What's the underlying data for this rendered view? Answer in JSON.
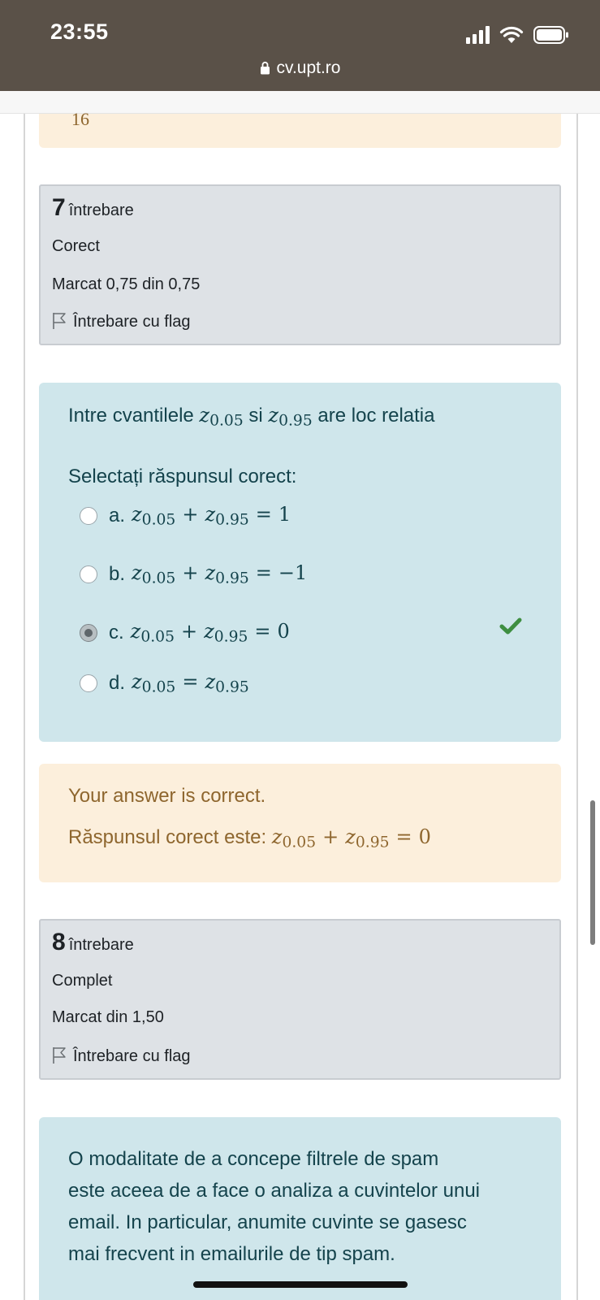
{
  "status_bar": {
    "time": "23:55",
    "url": "cv.upt.ro"
  },
  "prev_feedback_fragment": "16",
  "q7": {
    "number": "7",
    "label": "întrebare",
    "state": "Corect",
    "mark": "Marcat 0,75 din 0,75",
    "flag": "Întrebare cu flag",
    "text_prefix": "Intre cvantilele",
    "text_mid": "si",
    "text_suffix": "are loc relatia",
    "z": "z",
    "sub_a": "0.05",
    "sub_b": "0.95",
    "prompt": "Selectați răspunsul corect:",
    "options": [
      {
        "letter": "a.",
        "rhs": "1",
        "selected": false
      },
      {
        "letter": "b.",
        "rhs": "−1",
        "selected": false
      },
      {
        "letter": "c.",
        "rhs": "0",
        "selected": true
      },
      {
        "letter": "d.",
        "rhs": "",
        "selected": false
      }
    ],
    "feedback_correct": "Your answer is correct.",
    "feedback_answer": "Răspunsul corect este:",
    "answer_rhs": "0",
    "accent_correct": "#3e8e41"
  },
  "q8": {
    "number": "8",
    "label": "întrebare",
    "state": "Complet",
    "mark": "Marcat din 1,50",
    "flag": "Întrebare cu flag",
    "text_lines": [
      "O modalitate de a concepe filtrele de spam",
      "este aceea de a face o analiza a cuvintelor unui",
      "email. In particular, anumite cuvinte se gasesc",
      "mai frecvent in emailurile de tip spam."
    ]
  }
}
